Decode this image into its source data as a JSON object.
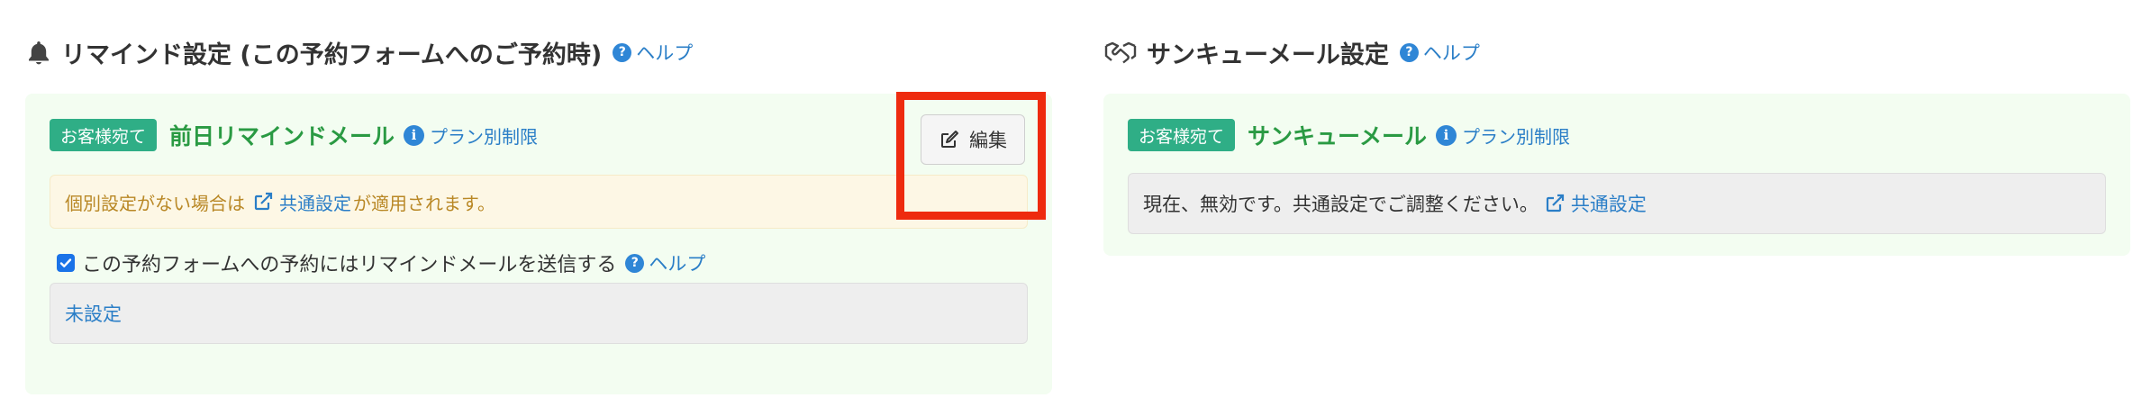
{
  "colors": {
    "badge_bg": "#2fae86",
    "mail_title": "#2a9a43",
    "link": "#2a7ec7",
    "panel_bg": "#f3fdf1",
    "alert_bg": "#fdf7e5",
    "alert_text": "#b98826",
    "highlight_border": "#ee2b0f"
  },
  "remind": {
    "title": "リマインド設定 (この予約フォームへのご予約時)",
    "icon": "bell-icon",
    "help_label": "ヘルプ",
    "badge": "お客様宛て",
    "mail_title": "前日リマインドメール",
    "plan_link": "プラン別制限",
    "edit_label": "編集",
    "alert": {
      "prefix": "個別設定がない場合は",
      "link": "共通設定",
      "suffix": "が適用されます。"
    },
    "checkbox": {
      "checked": true,
      "label": "この予約フォームへの予約にはリマインドメールを送信する",
      "help_label": "ヘルプ"
    },
    "value": "未設定"
  },
  "thanks": {
    "title": "サンキューメール設定",
    "icon": "handshake-icon",
    "help_label": "ヘルプ",
    "badge": "お客様宛て",
    "mail_title": "サンキューメール",
    "plan_link": "プラン別制限",
    "message": "現在、無効です。共通設定でご調整ください。",
    "link": "共通設定"
  }
}
